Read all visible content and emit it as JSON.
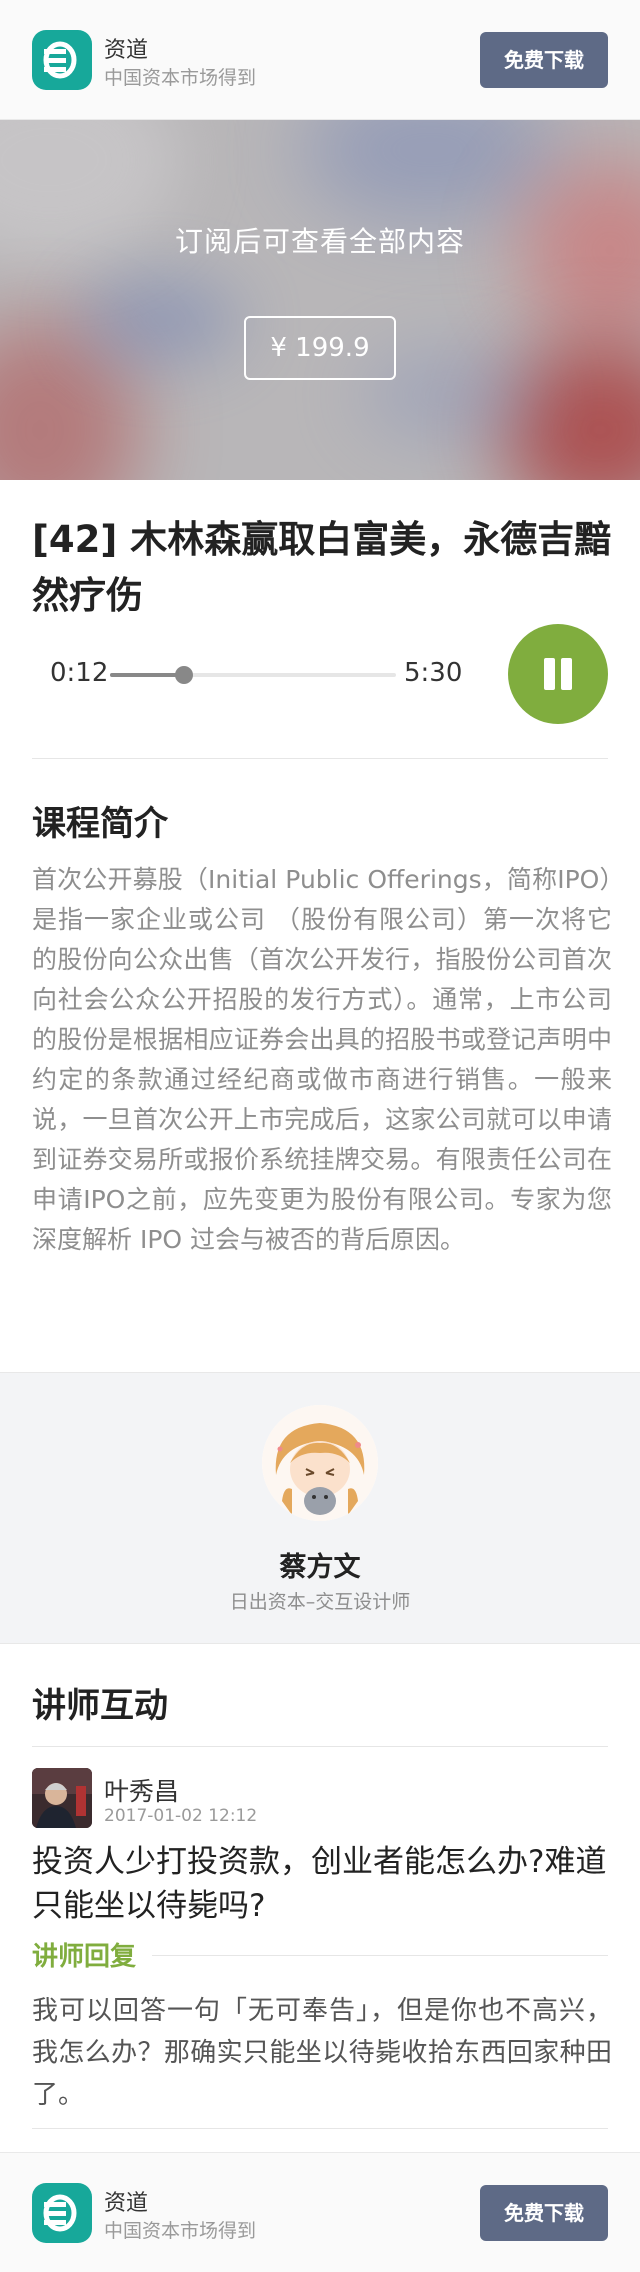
{
  "header": {
    "app_name": "资道",
    "tagline": "中国资本市场得到",
    "download_label": "免费下载"
  },
  "paywall": {
    "message": "订阅后可查看全部内容",
    "price": "¥ 199.9"
  },
  "lesson": {
    "title": "[42] 木林森赢取白富美，永德吉黯然疗伤"
  },
  "player": {
    "current_time": "0:12",
    "duration": "5:30",
    "progress": 0.26,
    "state": "playing",
    "accent_color": "#80ad3e"
  },
  "intro": {
    "heading": "课程简介",
    "text": "首次公开募股（Initial Public Offerings，简称IPO）是指一家企业或公司 （股份有限公司）第一次将它的股份向公众出售（首次公开发行，指股份公司首次向社会公众公开招股的发行方式）。通常，上市公司的股份是根据相应证券会出具的招股书或登记声明中约定的条款通过经纪商或做市商进行销售。一般来说，一旦首次公开上市完成后，这家公司就可以申请到证券交易所或报价系统挂牌交易。有限责任公司在申请IPO之前，应先变更为股份有限公司。专家为您深度解析 IPO 过会与被否的背后原因。"
  },
  "author": {
    "name": "蔡方文",
    "role": "日出资本–交互设计师"
  },
  "interaction": {
    "heading": "讲师互动",
    "user_name": "叶秀昌",
    "time": "2017-01-02 12:12",
    "question": "投资人少打投资款，创业者能怎么办?难道只能坐以待毙吗?",
    "reply_label": "讲师回复",
    "reply": "我可以回答一句「无可奉告」，但是你也不高兴，我怎么办？那确实只能坐以待毙收拾东西回家种田了。"
  },
  "footer": {
    "app_name": "资道",
    "tagline": "中国资本市场得到",
    "download_label": "免费下载"
  },
  "colors": {
    "brand": "#17a89a",
    "button": "#5e6a86",
    "muted_text": "#8e8e8e"
  }
}
